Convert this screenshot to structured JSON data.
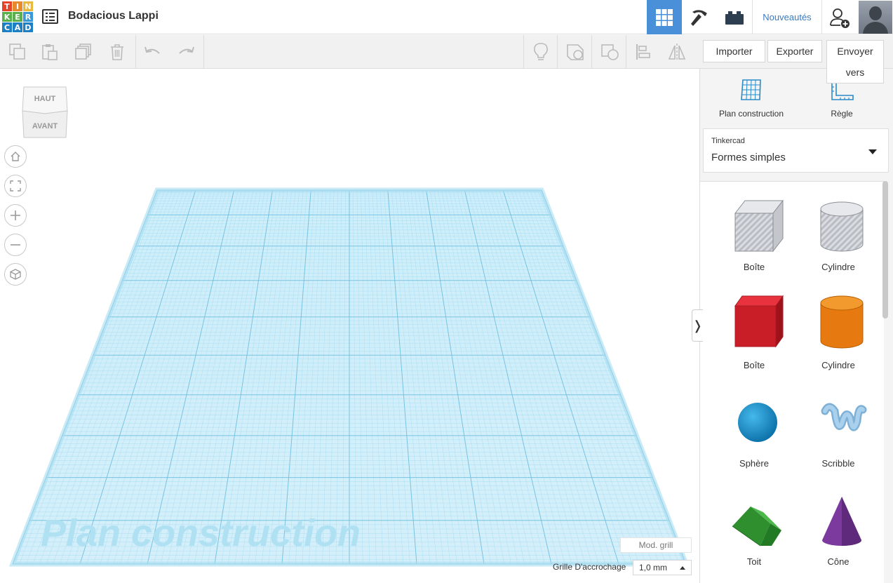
{
  "app": {
    "logo_letters": [
      "T",
      "I",
      "N",
      "K",
      "E",
      "R",
      "C",
      "A",
      "D"
    ],
    "logo_colors": [
      "#e5432a",
      "#e78a2e",
      "#e8b93c",
      "#5ab04a",
      "#5ab04a",
      "#3a9ad9",
      "#1e7fc2",
      "#1e7fc2",
      "#1e7fc2"
    ],
    "document_title": "Bodacious Lappi",
    "accent_color": "#4a90d9"
  },
  "topbar": {
    "views": [
      {
        "name": "3d-design-view",
        "icon": "grid-icon",
        "active": true
      },
      {
        "name": "codeblocks-view",
        "icon": "pickaxe-icon",
        "active": false
      },
      {
        "name": "bricks-view",
        "icon": "brick-icon",
        "active": false
      }
    ],
    "news_label": "Nouveautés",
    "add_user_icon": "add-user-icon",
    "avatar_icon": "avatar"
  },
  "toolbar": {
    "buttons": [
      "copy-icon",
      "paste-icon",
      "duplicate-icon",
      "delete-icon",
      "undo-icon",
      "redo-icon",
      "light-bulb-icon",
      "group-icon",
      "ungroup-icon",
      "align-icon",
      "mirror-icon"
    ],
    "import_label": "Importer",
    "export_label": "Exporter",
    "send_label": "Envoyer vers"
  },
  "viewcube": {
    "top_label": "HAUT",
    "front_label": "AVANT"
  },
  "nav_controls": [
    "home-icon",
    "fit-view-icon",
    "zoom-in-icon",
    "zoom-out-icon",
    "perspective-icon"
  ],
  "workplane": {
    "watermark": "Plan construction",
    "grid_color": "#8fd3ee",
    "mod_grid_label": "Mod. grill",
    "snap_label": "Grille D'accrochage",
    "snap_value": "1,0 mm"
  },
  "panel": {
    "tools": [
      {
        "label": "Plan construction",
        "icon": "workplane-icon"
      },
      {
        "label": "Règle",
        "icon": "ruler-icon"
      }
    ],
    "library_source": "Tinkercad",
    "library_name": "Formes simples",
    "collapse_glyph": "❭",
    "shapes": [
      {
        "label": "Boîte",
        "icon": "box-hole-icon"
      },
      {
        "label": "Cylindre",
        "icon": "cylinder-hole-icon"
      },
      {
        "label": "Boîte",
        "icon": "box-icon"
      },
      {
        "label": "Cylindre",
        "icon": "cylinder-icon"
      },
      {
        "label": "Sphère",
        "icon": "sphere-icon"
      },
      {
        "label": "Scribble",
        "icon": "scribble-icon"
      },
      {
        "label": "Toit",
        "icon": "roof-icon"
      },
      {
        "label": "Cône",
        "icon": "cone-icon"
      }
    ]
  }
}
